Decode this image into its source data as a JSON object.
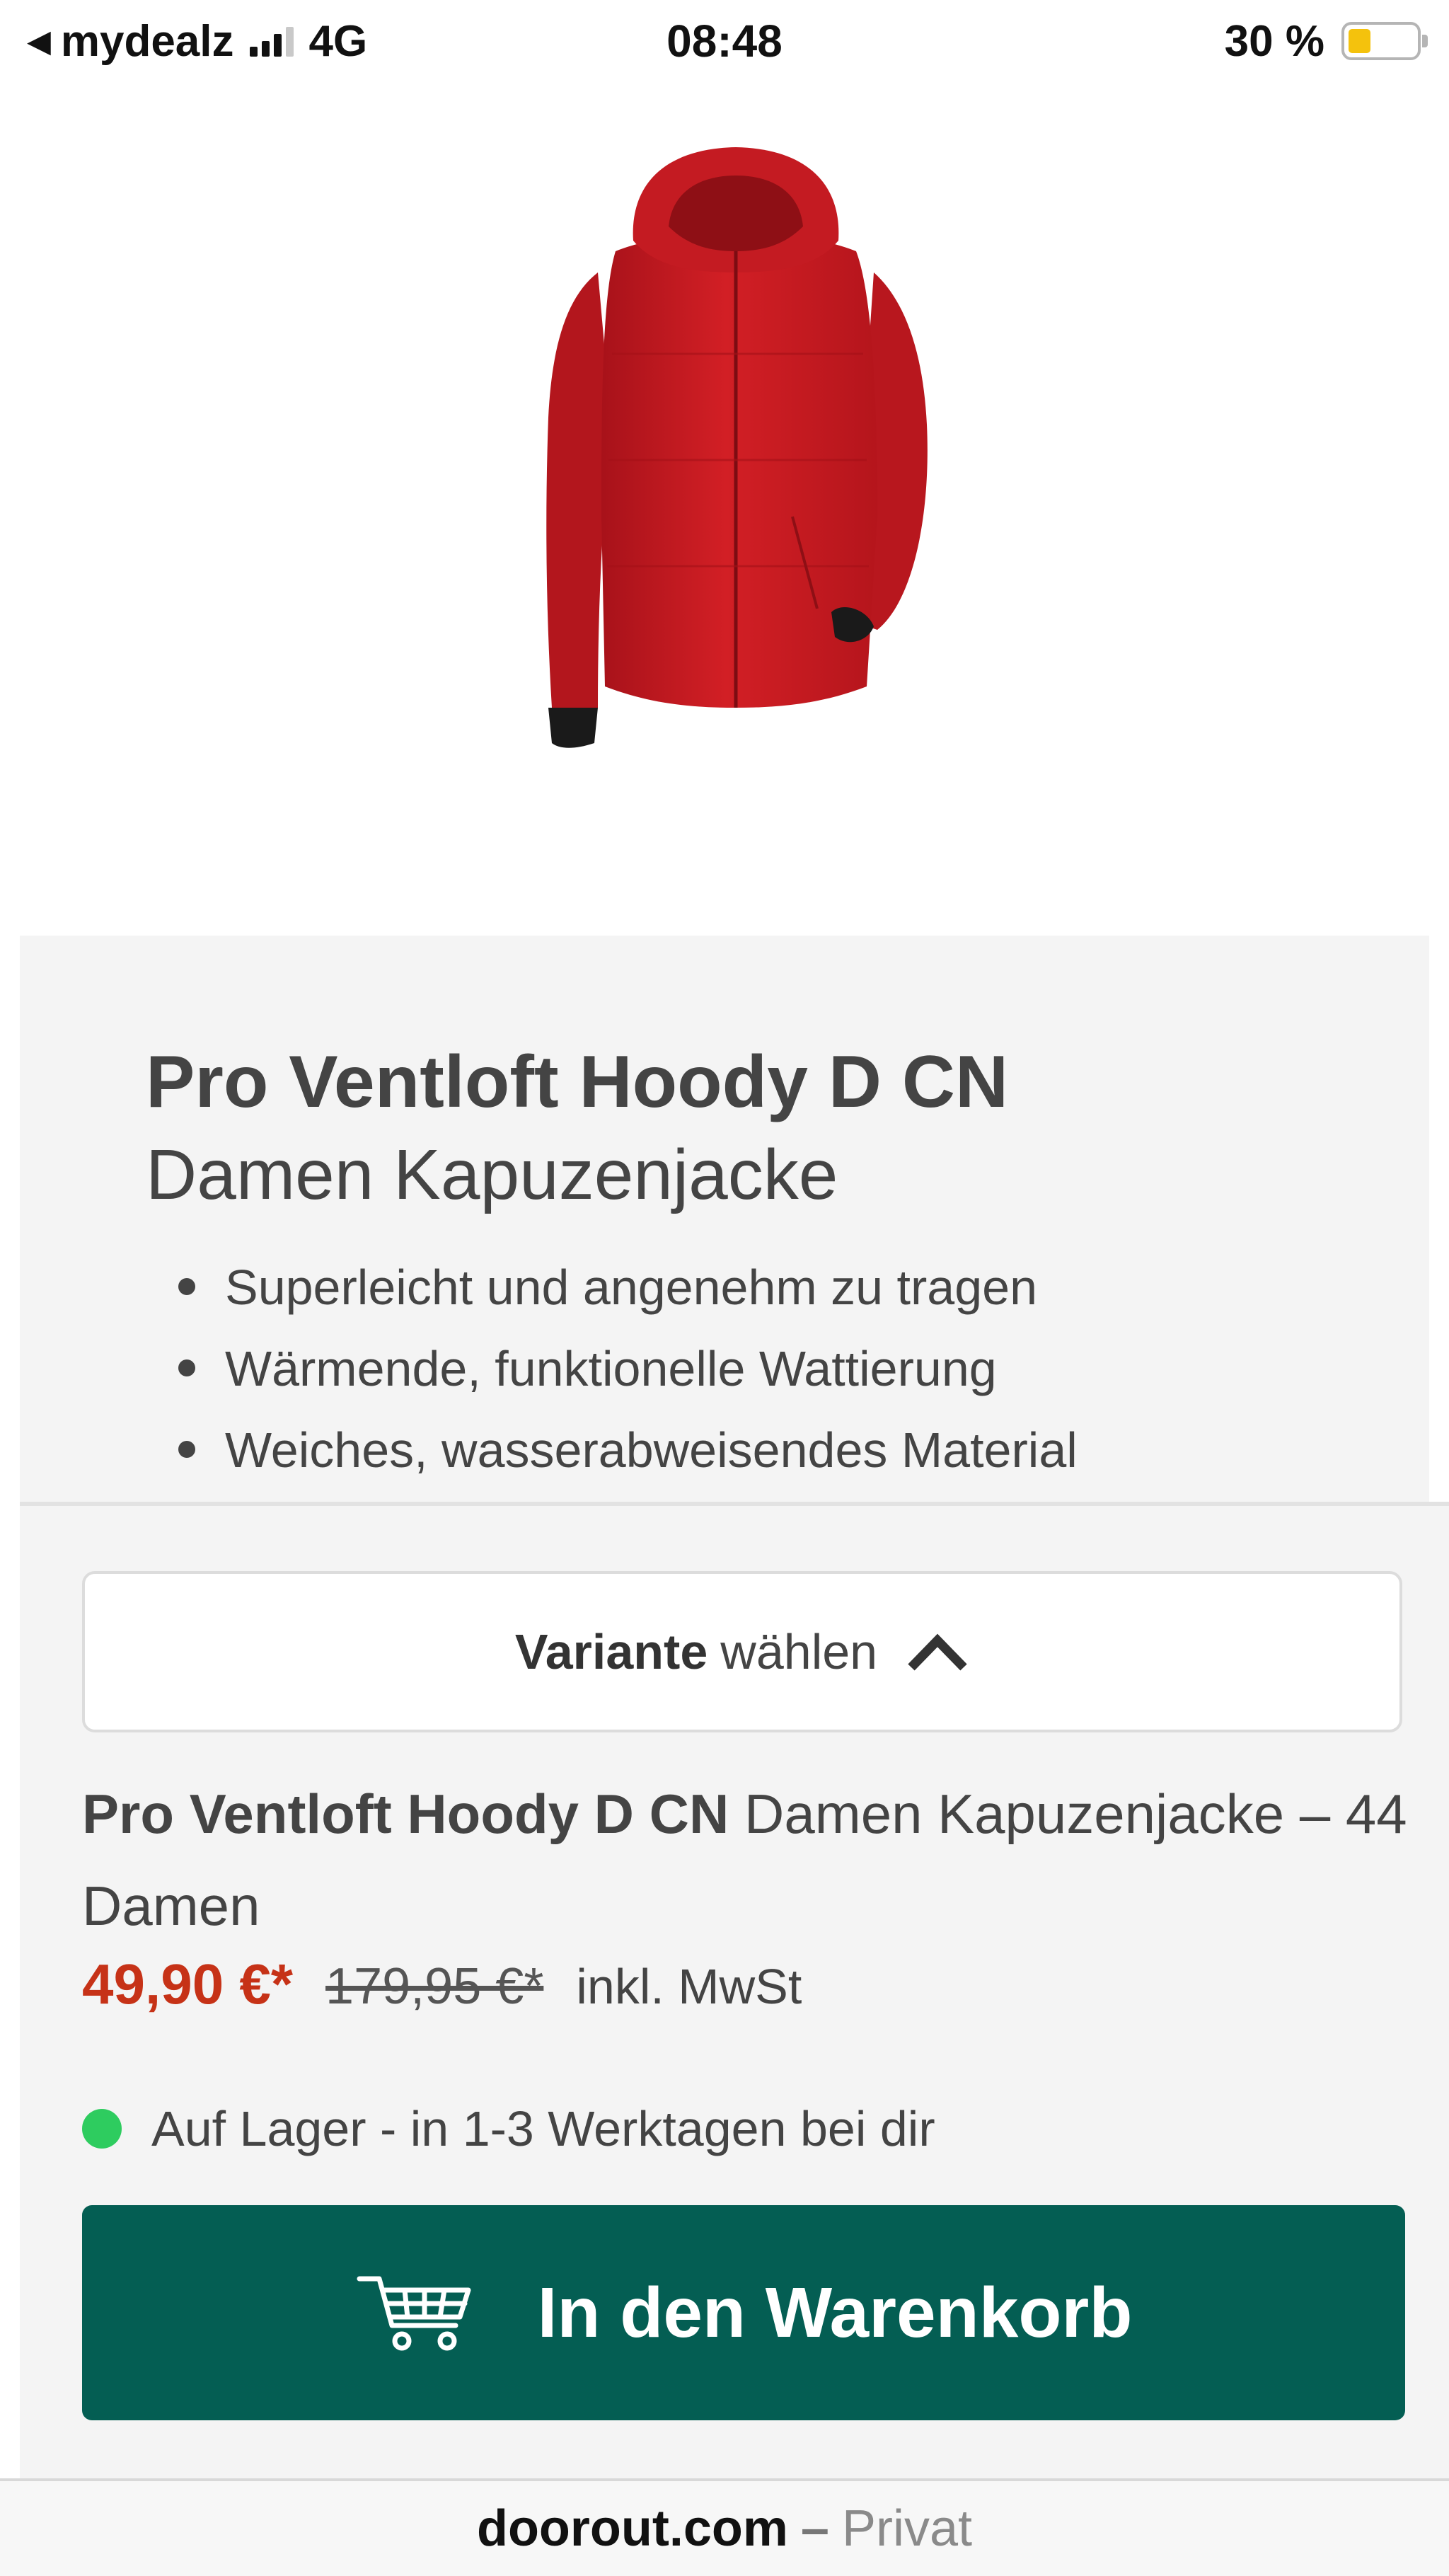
{
  "status_bar": {
    "back_app": "mydealz",
    "network": "4G",
    "time": "08:48",
    "battery_percent": "30 %",
    "battery_level": 0.3,
    "signal_bars_active": 3,
    "back_icon": "back-arrow-icon",
    "signal_icon": "signal-bars-icon",
    "battery_icon": "battery-icon",
    "battery_color": "#f4c20d"
  },
  "product": {
    "name": "Pro Ventloft Hoody D CN",
    "subtitle": "Damen Kapuzenjacke",
    "image_icon": "red-hooded-jacket-image",
    "features": [
      "Superleicht und angenehm zu tragen",
      "Wärmende, funktionelle Wattierung",
      "Weiches, wasserabweisendes Material"
    ]
  },
  "purchase": {
    "variant_strong": "Variante",
    "variant_rest": "wählen",
    "variant_icon": "chevron-up-icon",
    "selection_name": "Pro Ventloft Hoody D CN",
    "selection_detail": "Damen Kapuzenjacke – 44 Damen",
    "price_new": "49,90 €*",
    "price_old": "179,95 €*",
    "price_tax": "inkl. MwSt",
    "price_color": "#c63217",
    "stock_text": "Auf Lager - in 1-3 Werktagen bei dir",
    "stock_color": "#2ecc5f",
    "cart_label": "In den Warenkorb",
    "cart_icon": "shopping-cart-icon",
    "cart_color": "#045e53"
  },
  "url_bar": {
    "domain": "doorout.com",
    "separator": "–",
    "mode": "Privat"
  }
}
